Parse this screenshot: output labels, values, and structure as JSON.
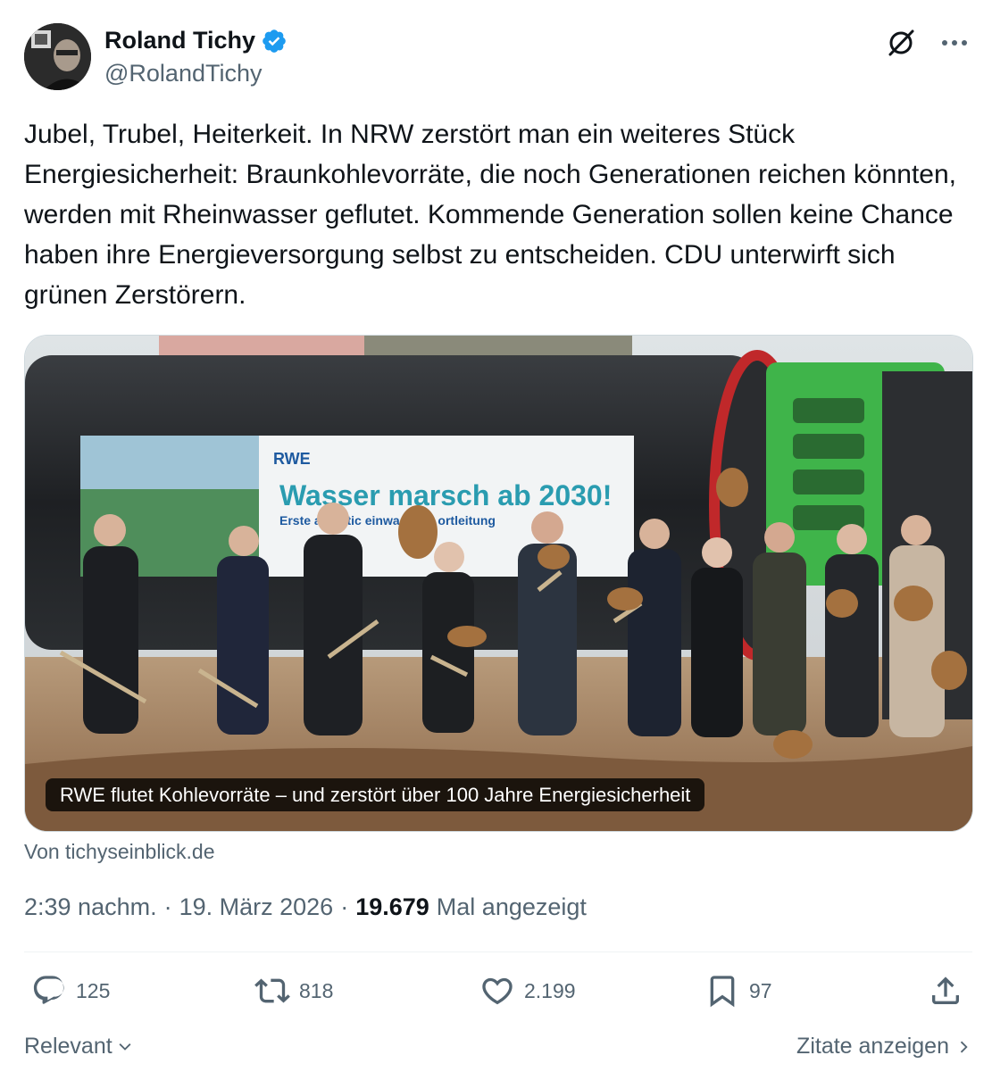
{
  "author": {
    "name": "Roland Tichy",
    "handle": "@RolandTichy",
    "verified": true,
    "verified_color": "#1d9bf0"
  },
  "header_icons": [
    "grok-icon",
    "more-options-icon"
  ],
  "tweet": {
    "text": "Jubel, Trubel, Heiterkeit. In NRW zerstört man ein weiteres Stück Energiesicherheit: Braunkohlevorräte, die noch Generationen reichen könnten, werden mit Rheinwasser geflutet. Kommende Generation sollen keine Chance haben ihre Energieversorgung selbst zu entscheiden. CDU unterwirft sich grünen Zerstörern."
  },
  "card": {
    "image_banner_brand": "RWE",
    "image_banner_headline": "Wasser marsch ab 2030!",
    "image_banner_subline": "Erste  atenstic  einwassertr  ortleitung",
    "caption": "RWE flutet Kohlevorräte – und zerstört über 100 Jahre Energiesicherheit",
    "source": "Von tichyseinblick.de"
  },
  "meta": {
    "time": "2:39 nachm.",
    "sep1": "·",
    "date": "19. März 2026",
    "sep2": "·",
    "views_count": "19.679",
    "views_label": "Mal angezeigt"
  },
  "actions": {
    "replies": "125",
    "reposts": "818",
    "likes": "2.199",
    "bookmarks": "97"
  },
  "footer": {
    "sort_label": "Relevant",
    "quotes_label": "Zitate anzeigen"
  },
  "colors": {
    "text_primary": "#0f1419",
    "text_secondary": "#536471",
    "divider": "#eff3f4"
  }
}
